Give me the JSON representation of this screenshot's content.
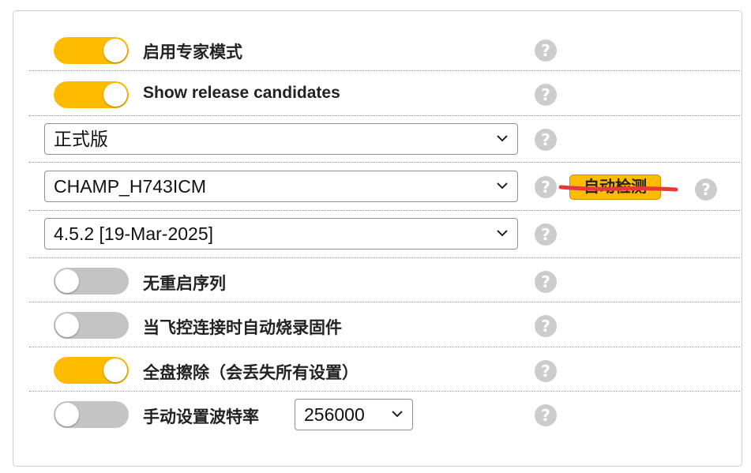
{
  "colors": {
    "accent": "#ffbb00",
    "toggle_off": "#c4c4c4",
    "help": "#cccccc",
    "strike": "#e5383b"
  },
  "expert_mode": {
    "label": "启用专家模式",
    "on": true
  },
  "show_rc": {
    "label": "Show release candidates",
    "on": true
  },
  "release_type_select": {
    "value": "正式版"
  },
  "board_select": {
    "value": "CHAMP_H743ICM"
  },
  "auto_detect": {
    "label": "自动检测"
  },
  "version_select": {
    "value": "4.5.2 [19-Mar-2025]"
  },
  "no_reboot": {
    "label": "无重启序列",
    "on": false
  },
  "flash_on_connect": {
    "label": "当飞控连接时自动烧录固件",
    "on": false
  },
  "full_chip_erase": {
    "label": "全盘擦除（会丢失所有设置）",
    "on": true
  },
  "manual_baud": {
    "label": "手动设置波特率",
    "on": false,
    "baud_value": "256000"
  },
  "help_icon_glyph": "?"
}
